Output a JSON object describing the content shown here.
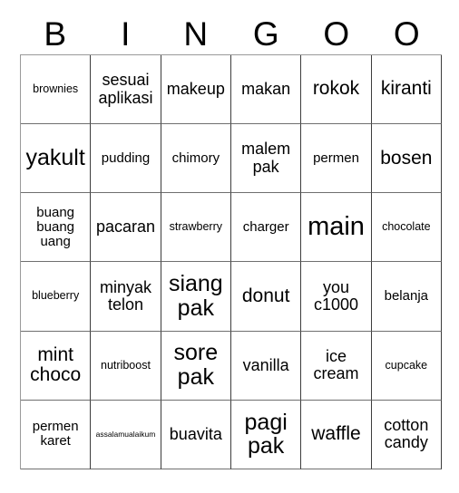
{
  "card": {
    "title": "BINGOO",
    "header_letters": [
      "B",
      "I",
      "N",
      "G",
      "O",
      "O"
    ],
    "columns": 6,
    "rows": 6,
    "colors": {
      "background": "#ffffff",
      "cell_background": "#ffffff",
      "grid_line": "#6f6f6f",
      "text": "#000000"
    },
    "cells": [
      {
        "text": "brownies",
        "size": "fs-xs"
      },
      {
        "text": "sesuai aplikasi",
        "size": "fs-m"
      },
      {
        "text": "makeup",
        "size": "fs-m"
      },
      {
        "text": "makan",
        "size": "fs-m"
      },
      {
        "text": "rokok",
        "size": "fs-l"
      },
      {
        "text": "kiranti",
        "size": "fs-l"
      },
      {
        "text": "yakult",
        "size": "fs-xl"
      },
      {
        "text": "pudding",
        "size": "fs-s"
      },
      {
        "text": "chimory",
        "size": "fs-s"
      },
      {
        "text": "malem pak",
        "size": "fs-m"
      },
      {
        "text": "permen",
        "size": "fs-s"
      },
      {
        "text": "bosen",
        "size": "fs-l"
      },
      {
        "text": "buang buang uang",
        "size": "fs-s"
      },
      {
        "text": "pacaran",
        "size": "fs-m"
      },
      {
        "text": "strawberry",
        "size": "fs-xs"
      },
      {
        "text": "charger",
        "size": "fs-s"
      },
      {
        "text": "main",
        "size": "fs-xxl"
      },
      {
        "text": "chocolate",
        "size": "fs-xs"
      },
      {
        "text": "blueberry",
        "size": "fs-xs"
      },
      {
        "text": "minyak telon",
        "size": "fs-m"
      },
      {
        "text": "siang pak",
        "size": "fs-xl"
      },
      {
        "text": "donut",
        "size": "fs-l"
      },
      {
        "text": "you c1000",
        "size": "fs-m"
      },
      {
        "text": "belanja",
        "size": "fs-s"
      },
      {
        "text": "mint choco",
        "size": "fs-l"
      },
      {
        "text": "nutriboost",
        "size": "fs-xs"
      },
      {
        "text": "sore pak",
        "size": "fs-xl"
      },
      {
        "text": "vanilla",
        "size": "fs-m"
      },
      {
        "text": "ice cream",
        "size": "fs-m"
      },
      {
        "text": "cupcake",
        "size": "fs-xs"
      },
      {
        "text": "permen karet",
        "size": "fs-s"
      },
      {
        "text": "assalamualaikum",
        "size": "fs-xxs"
      },
      {
        "text": "buavita",
        "size": "fs-m"
      },
      {
        "text": "pagi pak",
        "size": "fs-xl"
      },
      {
        "text": "waffle",
        "size": "fs-l"
      },
      {
        "text": "cotton candy",
        "size": "fs-m"
      }
    ]
  }
}
